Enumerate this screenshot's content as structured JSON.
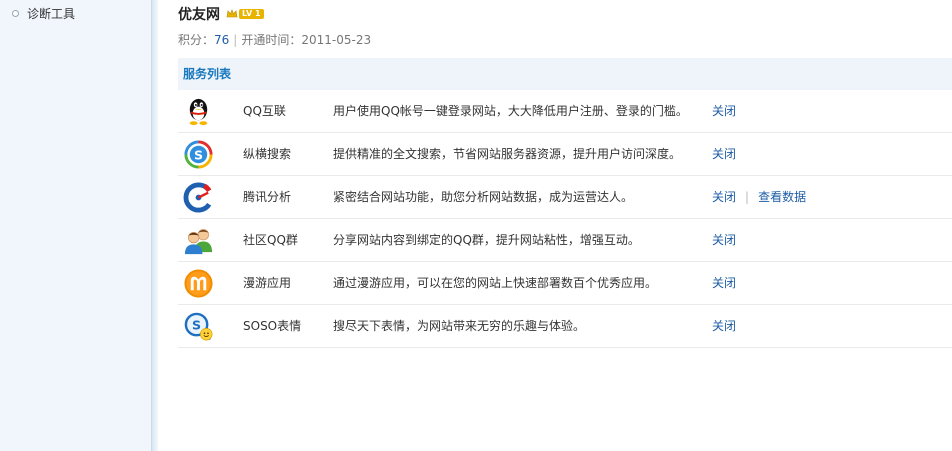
{
  "sidebar": {
    "items": [
      {
        "label": "诊断工具"
      }
    ]
  },
  "header": {
    "site_name": "优友网",
    "level_badge": "LV 1",
    "score_label": "积分：",
    "score_value": "76",
    "separator": "|",
    "opened_label": "开通时间：",
    "opened_date": "2011-05-23"
  },
  "services": {
    "title": "服务列表",
    "action_separator": "|",
    "rows": [
      {
        "icon": "qq-penguin-icon",
        "name": "QQ互联",
        "desc": "用户使用QQ帐号一键登录网站，大大降低用户注册、登录的门槛。",
        "action": "关闭"
      },
      {
        "icon": "soso-search-icon",
        "name": "纵横搜索",
        "desc": "提供精准的全文搜索，节省网站服务器资源，提升用户访问深度。",
        "action": "关闭"
      },
      {
        "icon": "analytics-gauge-icon",
        "name": "腾讯分析",
        "desc": "紧密结合网站功能，助您分析网站数据，成为运营达人。",
        "action": "关闭",
        "extra_action": "查看数据"
      },
      {
        "icon": "users-group-icon",
        "name": "社区QQ群",
        "desc": "分享网站内容到绑定的QQ群，提升网站粘性，增强互动。",
        "action": "关闭"
      },
      {
        "icon": "manyou-app-icon",
        "name": "漫游应用",
        "desc": "通过漫游应用，可以在您的网站上快速部署数百个优秀应用。",
        "action": "关闭"
      },
      {
        "icon": "soso-emoticon-icon",
        "name": "SOSO表情",
        "desc": "搜尽天下表情，为网站带来无穷的乐趣与体验。",
        "action": "关闭"
      }
    ]
  },
  "colors": {
    "link": "#1e5da6",
    "section_title": "#1878be",
    "section_bg": "#eef4fa",
    "sidebar_bg": "#f0f6fb"
  }
}
